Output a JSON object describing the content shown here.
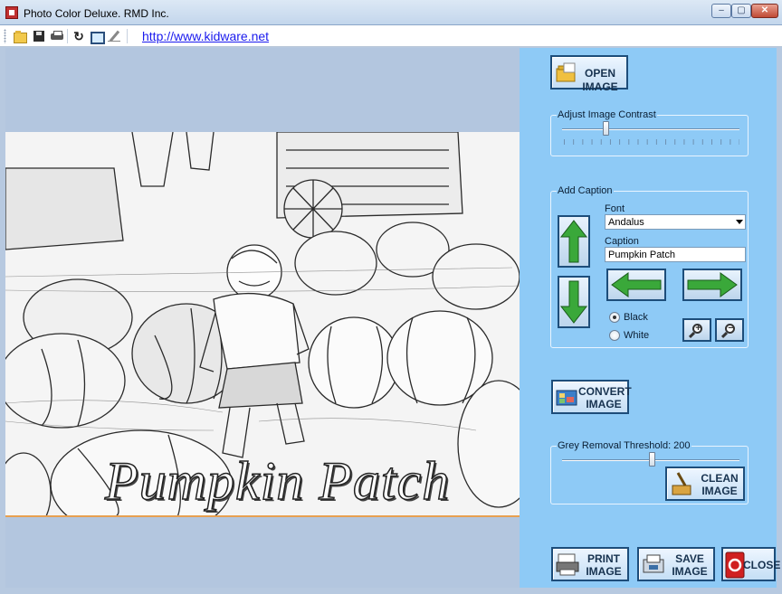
{
  "window": {
    "title": "Photo Color Deluxe.  RMD Inc.",
    "controls": {
      "minimize": "‒",
      "maximize": "▢",
      "close": "✕"
    }
  },
  "toolbar": {
    "icons": [
      "open-folder-icon",
      "save-icon",
      "print-icon",
      "refresh-icon",
      "screen-icon",
      "pen-icon"
    ],
    "link": "http://www.kidware.net"
  },
  "image": {
    "caption_overlay": "Pumpkin Patch"
  },
  "buttons": {
    "open_image": "OPEN IMAGE",
    "convert_image_line1": "CONVERT",
    "convert_image_line2": "IMAGE",
    "clean_image_line1": "CLEAN",
    "clean_image_line2": "IMAGE",
    "print_image_line1": "PRINT",
    "print_image_line2": "IMAGE",
    "save_image_line1": "SAVE",
    "save_image_line2": "IMAGE",
    "close": "CLOSE"
  },
  "contrast": {
    "title": "Adjust Image Contrast",
    "value_fraction": 0.24
  },
  "caption": {
    "title": "Add Caption",
    "font_label": "Font",
    "font_value": "Andalus",
    "caption_label": "Caption",
    "caption_value": "Pumpkin Patch",
    "radio_black": "Black",
    "radio_white": "White",
    "selected_color": "Black"
  },
  "threshold": {
    "title": "Grey Removal Threshold: 200",
    "value_fraction": 0.51
  },
  "colors": {
    "right_panel": "#8ecaf6",
    "left_panel": "#b3c6df",
    "arrow_green": "#3aa83a"
  }
}
